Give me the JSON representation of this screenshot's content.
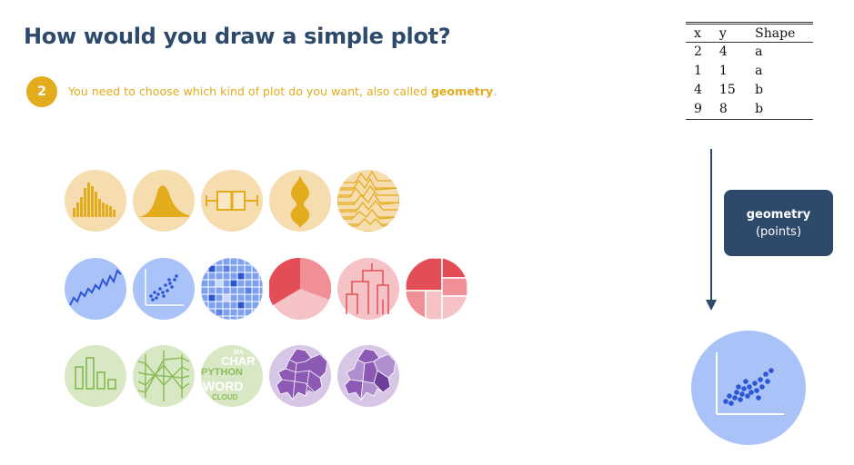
{
  "title": "How would you draw a simple plot?",
  "step": {
    "number": "2",
    "text": "You need to choose which kind of plot do you want, also called ",
    "highlight": "geometry",
    "end": "."
  },
  "table": {
    "headers": [
      "x",
      "y",
      "Shape"
    ],
    "rows": [
      [
        "2",
        "4",
        "a"
      ],
      [
        "1",
        "1",
        "a"
      ],
      [
        "4",
        "15",
        "b"
      ],
      [
        "9",
        "8",
        "b"
      ]
    ]
  },
  "geometry_box": {
    "line1": "geometry",
    "line2": "(points)"
  },
  "wordcloud_words": [
    "PYTHON",
    "CHAR",
    "WORD",
    "CLOUD",
    "MA"
  ],
  "icons": [
    "histogram-icon",
    "density-icon",
    "boxplot-icon",
    "violin-icon",
    "ridgeline-icon",
    "line-chart-icon",
    "scatter-icon",
    "heatmap-icon",
    "pie-icon",
    "dendrogram-icon",
    "treemap-icon",
    "barplot-icon",
    "parallel-icon",
    "wordcloud-icon",
    "map-icon",
    "choropleth-icon"
  ],
  "colors": {
    "title": "#2e4a6b",
    "accent": "#e3ac1c",
    "distribution_bg": "#f6ddb0",
    "distribution_fg": "#e3ac1c",
    "correlation_bg": "#a9c2f7",
    "correlation_fg": "#2d56d6",
    "partwhole_bg": "#f5c2c5",
    "partwhole_fg": "#e34d56",
    "ranking_bg": "#d8e8c4",
    "ranking_fg": "#8cbd5a",
    "map_bg": "#d7c6e6",
    "map_fg": "#8c5ab4",
    "arrow": "#2e4a6b"
  }
}
